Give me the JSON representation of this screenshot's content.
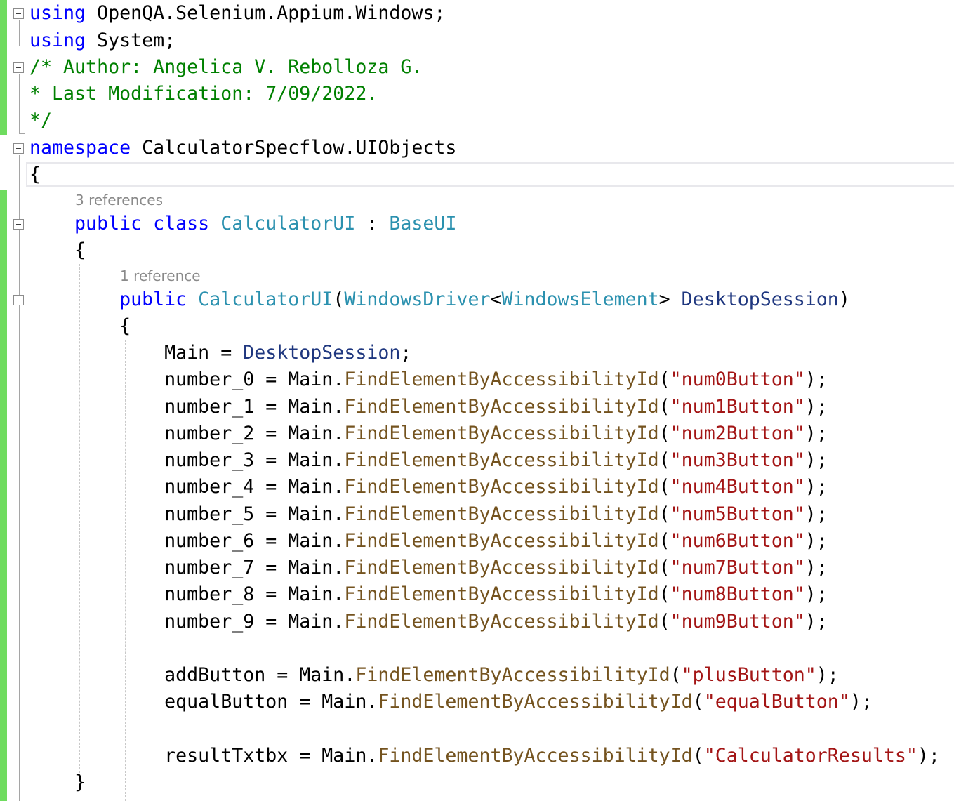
{
  "code": {
    "line1": {
      "kw": "using",
      "rest": " OpenQA.Selenium.Appium.Windows;"
    },
    "line2": {
      "kw": "using",
      "rest": " System;"
    },
    "comment": [
      "/* Author: Angelica V. Rebolloza G.",
      "* Last Modification: 7/09/2022.",
      "*/"
    ],
    "namespace_line": {
      "kw": "namespace",
      "name": " CalculatorSpecflow.UIObjects"
    },
    "ns_open": "{",
    "class_codelens": "3 references",
    "class_line": {
      "kw1": "public",
      "kw2": " class",
      "name": " CalculatorUI",
      "colon": " : ",
      "base": "BaseUI"
    },
    "class_open": "{",
    "ctor_codelens": "1 reference",
    "ctor_line": {
      "kw": "public",
      "name": " CalculatorUI",
      "paren_open": "(",
      "type1": "WindowsDriver",
      "lt": "<",
      "type2": "WindowsElement",
      "gt": "> ",
      "param": "DesktopSession",
      "paren_close": ")"
    },
    "ctor_open": "{",
    "main_line": {
      "lhs": "Main = ",
      "rhs": "DesktopSession",
      "end": ";"
    },
    "number_lines": [
      {
        "lhs": "number_0 = Main.",
        "str": "\"num0Button\""
      },
      {
        "lhs": "number_1 = Main.",
        "str": "\"num1Button\""
      },
      {
        "lhs": "number_2 = Main.",
        "str": "\"num2Button\""
      },
      {
        "lhs": "number_3 = Main.",
        "str": "\"num3Button\""
      },
      {
        "lhs": "number_4 = Main.",
        "str": "\"num4Button\""
      },
      {
        "lhs": "number_5 = Main.",
        "str": "\"num5Button\""
      },
      {
        "lhs": "number_6 = Main.",
        "str": "\"num6Button\""
      },
      {
        "lhs": "number_7 = Main.",
        "str": "\"num7Button\""
      },
      {
        "lhs": "number_8 = Main.",
        "str": "\"num8Button\""
      },
      {
        "lhs": "number_9 = Main.",
        "str": "\"num9Button\""
      }
    ],
    "method": "FindElementByAccessibilityId",
    "open_paren": "(",
    "close_paren": ");",
    "add_line": {
      "lhs": "addButton = Main.",
      "str": "\"plusButton\""
    },
    "equal_line": {
      "lhs": "equalButton = Main.",
      "str": "\"equalButton\""
    },
    "result_line": {
      "lhs": "resultTxtbx = Main.",
      "str": "\"CalculatorResults\""
    },
    "ctor_close": "}"
  }
}
